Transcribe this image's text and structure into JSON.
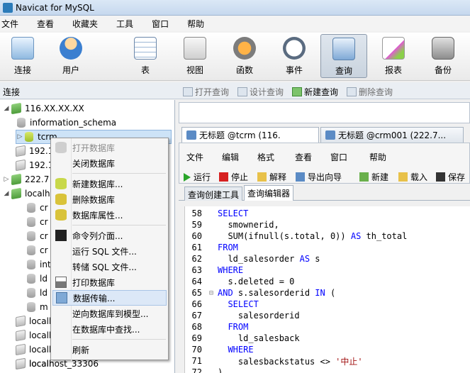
{
  "window": {
    "title": "Navicat for MySQL"
  },
  "menu": [
    "文件",
    "查看",
    "收藏夹",
    "工具",
    "窗口",
    "帮助"
  ],
  "toolbar": [
    {
      "label": "连接",
      "icon": "connect-icon"
    },
    {
      "label": "用户",
      "icon": "user-icon"
    },
    {
      "label": "表",
      "icon": "table-icon"
    },
    {
      "label": "视图",
      "icon": "view-icon"
    },
    {
      "label": "函数",
      "icon": "function-icon"
    },
    {
      "label": "事件",
      "icon": "event-icon"
    },
    {
      "label": "查询",
      "icon": "query-icon"
    },
    {
      "label": "报表",
      "icon": "report-icon"
    },
    {
      "label": "备份",
      "icon": "backup-icon"
    }
  ],
  "subbar": {
    "connection_label": "连接",
    "actions": [
      {
        "label": "打开查询",
        "enabled": false
      },
      {
        "label": "设计查询",
        "enabled": false
      },
      {
        "label": "新建查询",
        "enabled": true
      },
      {
        "label": "删除查询",
        "enabled": false
      }
    ]
  },
  "tree": [
    {
      "label": "116.XX.XX.XX",
      "kind": "server",
      "expanded": true
    },
    {
      "label": "information_schema",
      "kind": "db"
    },
    {
      "label": "tcrm",
      "kind": "db-open"
    },
    {
      "label": "192.1",
      "kind": "server-off"
    },
    {
      "label": "192.1",
      "kind": "server-off"
    },
    {
      "label": "222.7",
      "kind": "server"
    },
    {
      "label": "localh",
      "kind": "server"
    },
    {
      "label": "cr",
      "kind": "db"
    },
    {
      "label": "cr",
      "kind": "db"
    },
    {
      "label": "cr",
      "kind": "db"
    },
    {
      "label": "cr",
      "kind": "db"
    },
    {
      "label": "int",
      "kind": "db"
    },
    {
      "label": "ld",
      "kind": "db"
    },
    {
      "label": "ld",
      "kind": "db"
    },
    {
      "label": "m",
      "kind": "db"
    },
    {
      "label": "localh",
      "kind": "server-off"
    },
    {
      "label": "localh",
      "kind": "server-off"
    },
    {
      "label": "localh",
      "kind": "server-off"
    },
    {
      "label": "localh",
      "kind": "server-off"
    },
    {
      "label": "localhost_33306",
      "kind": "server-off"
    }
  ],
  "context_menu": {
    "items": [
      {
        "label": "打开数据库",
        "disabled": true
      },
      {
        "label": "关闭数据库"
      },
      {
        "label": "新建数据库..."
      },
      {
        "label": "删除数据库"
      },
      {
        "label": "数据库属性..."
      },
      {
        "label": "命令列介面..."
      },
      {
        "label": "运行 SQL 文件..."
      },
      {
        "label": "转储 SQL 文件..."
      },
      {
        "label": "打印数据库"
      },
      {
        "label": "数据传输...",
        "hover": true
      },
      {
        "label": "逆向数据库到模型..."
      },
      {
        "label": "在数据库中查找..."
      },
      {
        "label": "刷新"
      }
    ]
  },
  "tabs": [
    {
      "label": "无标题 @tcrm (116.",
      "active": true
    },
    {
      "label": "无标题 @crm001 (222.7...",
      "active": false
    }
  ],
  "editor_menu": [
    "文件",
    "编辑",
    "格式",
    "查看",
    "窗口",
    "帮助"
  ],
  "editor_actions": [
    "运行",
    "停止",
    "解释",
    "导出向导",
    "新建",
    "载入",
    "保存"
  ],
  "subtabs": [
    "查询创建工具",
    "查询编辑器"
  ],
  "code": [
    {
      "n": "58",
      "text": "SELECT"
    },
    {
      "n": "59",
      "text": "  smownerid,"
    },
    {
      "n": "60",
      "text": "  SUM(ifnull(s.total, 0)) AS th_total"
    },
    {
      "n": "61",
      "text": "FROM"
    },
    {
      "n": "62",
      "text": "  ld_salesorder AS s"
    },
    {
      "n": "63",
      "text": "WHERE"
    },
    {
      "n": "64",
      "text": "  s.deleted = 0"
    },
    {
      "n": "65",
      "text": "AND s.salesorderid IN ("
    },
    {
      "n": "66",
      "text": "  SELECT"
    },
    {
      "n": "67",
      "text": "    salesorderid"
    },
    {
      "n": "68",
      "text": "  FROM"
    },
    {
      "n": "69",
      "text": "    ld_salesback"
    },
    {
      "n": "70",
      "text": "  WHERE"
    },
    {
      "n": "71",
      "text": "    salesbackstatus <> '中止'"
    },
    {
      "n": "72",
      "text": ")"
    }
  ]
}
